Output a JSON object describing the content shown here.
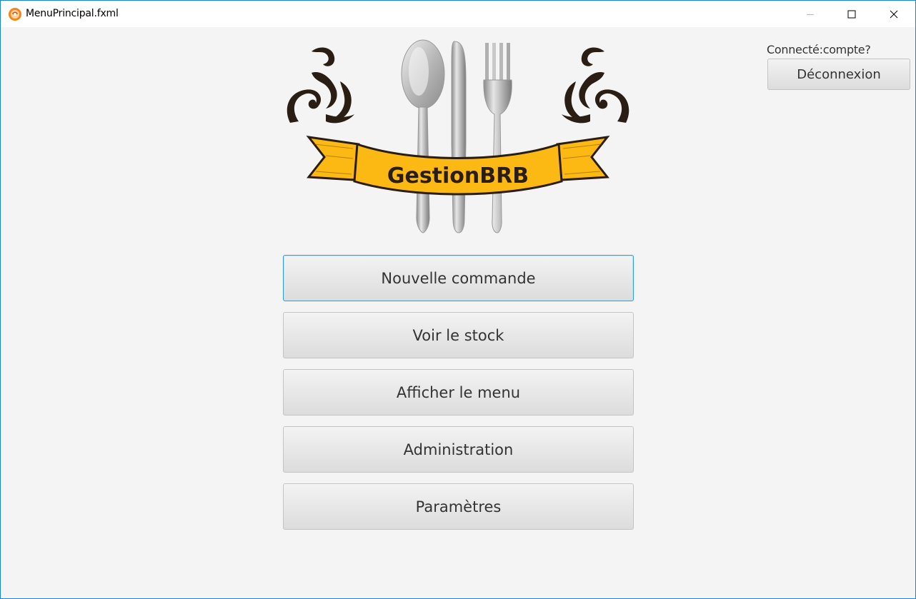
{
  "window": {
    "title": "MenuPrincipal.fxml",
    "app_icon": "java-fx-app-icon",
    "controls": [
      "minimize-icon",
      "maximize-icon",
      "close-icon"
    ]
  },
  "header": {
    "connected_label": "Connecté:compte?",
    "logout_label": "Déconnexion"
  },
  "logo": {
    "text": "GestionBRB",
    "icons": [
      "spoon-icon",
      "knife-icon",
      "fork-icon"
    ]
  },
  "menu": {
    "buttons": [
      {
        "label": "Nouvelle commande",
        "focused": true
      },
      {
        "label": "Voir le stock"
      },
      {
        "label": "Afficher le menu"
      },
      {
        "label": "Administration"
      },
      {
        "label": "Paramètres"
      }
    ]
  },
  "colors": {
    "focus_border": "#2a9ee3",
    "banner_yellow": "#fdb913",
    "background": "#f4f4f4"
  }
}
